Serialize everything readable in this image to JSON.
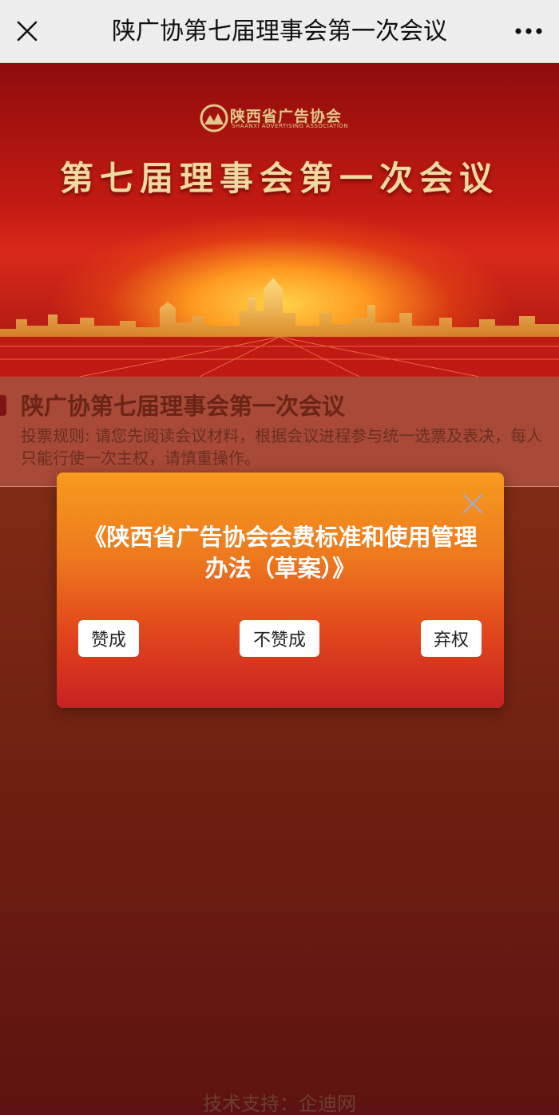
{
  "nav": {
    "title": "陕广协第七届理事会第一次会议",
    "close_icon": "close-icon",
    "more_icon": "more-dots-icon"
  },
  "banner": {
    "logo_text": "陕西省广告协会",
    "logo_subtext": "SHAANXI ADVERTISING ASSOCIATION",
    "title": "第七届理事会第一次会议"
  },
  "info": {
    "title": "陕广协第七届理事会第一次会议",
    "rules": "投票规则: 请您先阅读会议材料，根据会议进程参与统一选票及表决，每人只能行使一次主权，请慎重操作。"
  },
  "modal": {
    "title": "《陕西省广告协会会费标准和使用管理办法（草案）》",
    "close_icon": "close-icon",
    "buttons": {
      "agree": "赞成",
      "disagree": "不赞成",
      "abstain": "弃权"
    }
  },
  "footer": {
    "text": "技术支持：企迪网"
  },
  "colors": {
    "nav_bg": "#ededed",
    "page_red": "#8e1f15",
    "modal_top": "#f59b1e",
    "modal_bottom": "#c72222",
    "gold_text": "#f1d9a0"
  }
}
